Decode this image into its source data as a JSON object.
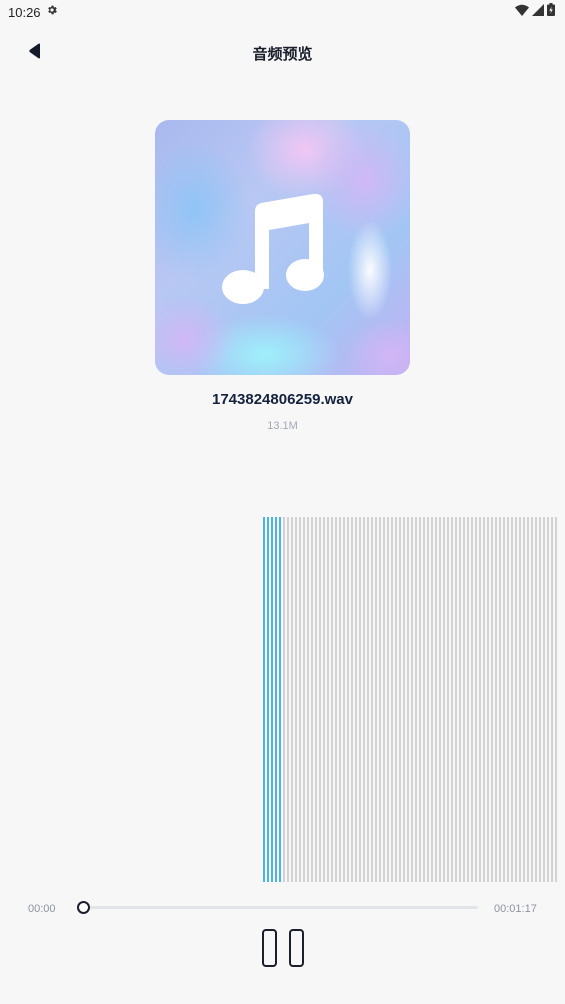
{
  "status_bar": {
    "time": "10:26",
    "icons": [
      "settings-gear-icon",
      "wifi-icon",
      "signal-icon",
      "battery-icon"
    ]
  },
  "header": {
    "title": "音频预览",
    "back_icon": "back-arrow-icon"
  },
  "file": {
    "name": "1743824806259.wav",
    "size": "13.1M",
    "cover_icon": "music-note-icon"
  },
  "player": {
    "current_time": "00:00",
    "total_time": "00:01:17",
    "progress": 0,
    "state_icon": "pause-icon"
  },
  "colors": {
    "waveform_played": "#4ab3e2",
    "waveform_unplayed": "#d2d2d4",
    "text_primary": "#16233d",
    "text_secondary": "#a2a8b3"
  }
}
